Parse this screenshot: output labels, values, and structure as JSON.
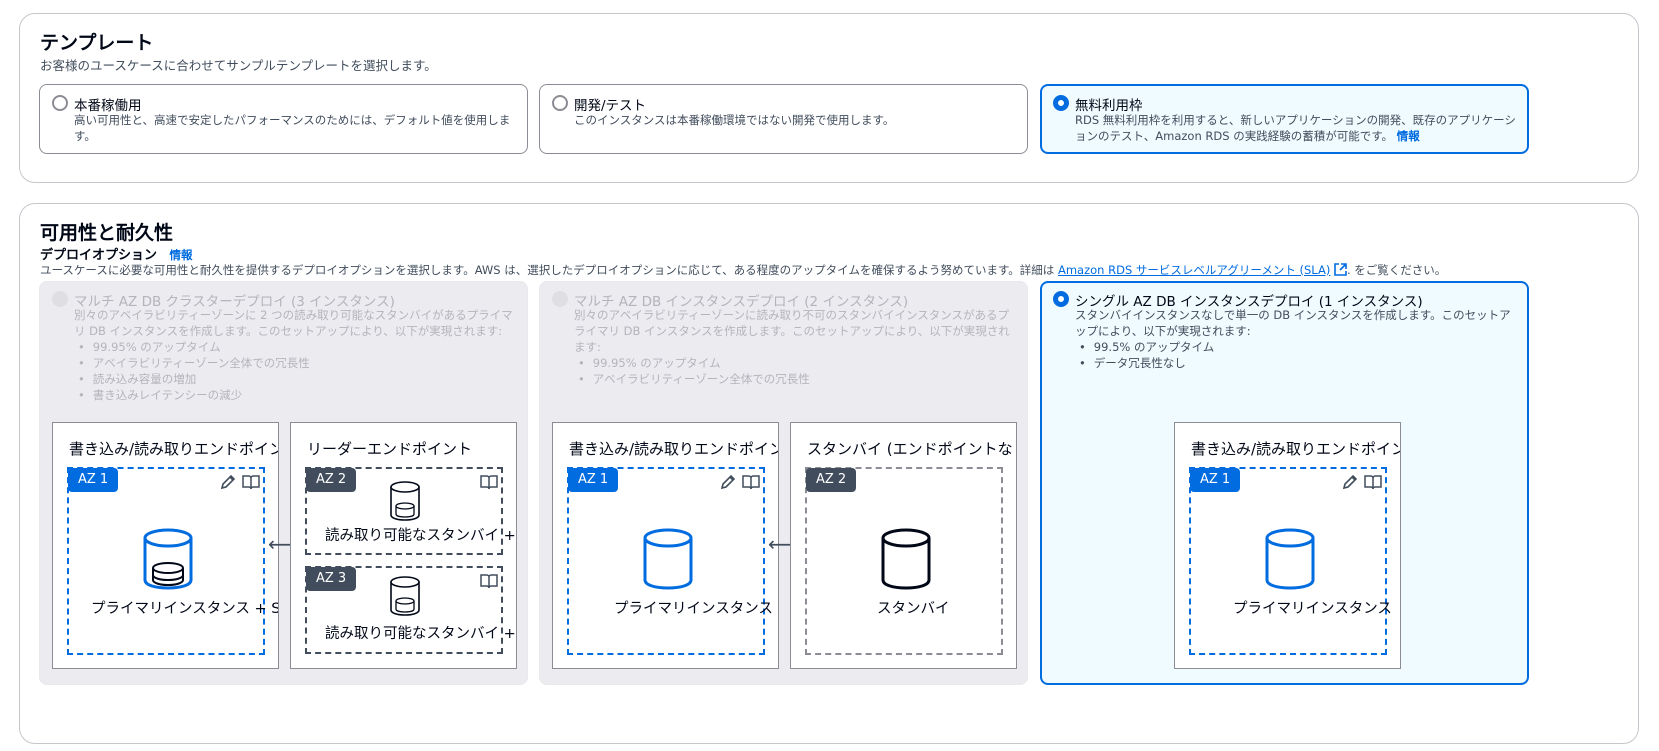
{
  "template": {
    "title": "テンプレート",
    "description": "お客様のユースケースに合わせてサンプルテンプレートを選択します。",
    "options": [
      {
        "label": "本番稼働用",
        "description": "高い可用性と、高速で安定したパフォーマンスのためには、デフォルト値を使用しま す。",
        "selected": false
      },
      {
        "label": "開発/テスト",
        "description": "このインスタンスは本番稼働環境ではない開発で使用します。",
        "selected": false
      },
      {
        "label": "無料利用枠",
        "description": "RDS 無料利用枠を利用すると、新しいアプリケーションの開発、既存のアプリケーションのテスト、Amazon RDS の実践経験の蓄積が可能です。",
        "info_link": "情報",
        "selected": true
      }
    ]
  },
  "availability": {
    "title": "可用性と耐久性",
    "deploy_label": "デプロイオプション",
    "info_link": "情報",
    "description_prefix": "ユースケースに必要な可用性と耐久性を提供するデプロイオプションを選択します。AWS は、選択したデプロイオプションに応じて、ある程度のアップタイムを確保するよう努めています。詳細は",
    "sla_link": "Amazon RDS サービスレベルアグリーメント (SLA)",
    "description_suffix": ". をご覧ください。",
    "options": [
      {
        "label": "マルチ AZ DB クラスターデプロイ (3 インスタンス)",
        "description": "別々のアベイラビリティーゾーンに 2 つの読み取り可能なスタンバイがあるプライマリ DB インスタンスを作成します。このセットアップにより、以下が実現されます:",
        "bullets": [
          "99.95% のアップタイム",
          "アベイラビリティーゾーン全体での冗長性",
          "読み込み容量の増加",
          "書き込みレイテンシーの減少"
        ],
        "disabled": true,
        "diagram": {
          "left_title": "書き込み/読み取りエンドポイント",
          "right_title": "リーダーエンドポイント",
          "az1": "AZ 1",
          "az2": "AZ 2",
          "az3": "AZ 3",
          "primary": "プライマリインスタンス + SSD",
          "standby1": "読み取り可能なスタンバイ +",
          "standby2": "読み取り可能なスタンバイ +",
          "arrow": "⟷"
        }
      },
      {
        "label": "マルチ AZ DB インスタンスデプロイ (2 インスタンス)",
        "description": "別々のアベイラビリティーゾーンに読み取り不可のスタンバイインスタンスがあるプライマリ DB インスタンスを作成します。このセットアップにより、以下が実現されます:",
        "bullets": [
          "99.95% のアップタイム",
          "アベイラビリティーゾーン全体での冗長性"
        ],
        "disabled": true,
        "diagram": {
          "left_title": "書き込み/読み取りエンドポイント",
          "right_title": "スタンバイ (エンドポイントなし",
          "az1": "AZ 1",
          "az2": "AZ 2",
          "primary": "プライマリインスタンス",
          "standby": "スタンバイ",
          "arrow": "⟷"
        }
      },
      {
        "label": "シングル AZ DB インスタンスデプロイ (1 インスタンス)",
        "description": "スタンバイインスタンスなしで単一の DB インスタンスを作成します。このセットアップにより、以下が実現されます:",
        "bullets": [
          "99.5% のアップタイム",
          "データ冗長性なし"
        ],
        "disabled": false,
        "selected": true,
        "diagram": {
          "title": "書き込み/読み取りエンドポイント",
          "az1": "AZ 1",
          "primary": "プライマリインスタンス"
        }
      }
    ]
  },
  "colors": {
    "accent": "#006ce0",
    "selected_bg": "#f0fbff",
    "disabled_bg": "#ebebf0"
  },
  "icons": [
    "radio-button",
    "pencil-icon",
    "book-icon",
    "database-icon",
    "external-link-icon",
    "bidirectional-arrow-icon"
  ]
}
